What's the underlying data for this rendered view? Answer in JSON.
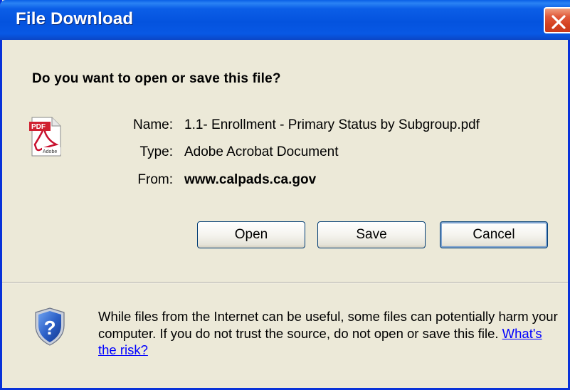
{
  "window": {
    "title": "File Download",
    "close_icon": "close-icon"
  },
  "dialog": {
    "question": "Do you want to open or save this file?",
    "file_icon": "pdf-file-icon",
    "fields": [
      {
        "label": "Name:",
        "value": "1.1- Enrollment - Primary Status by Subgroup.pdf",
        "bold": false
      },
      {
        "label": "Type:",
        "value": "Adobe Acrobat Document",
        "bold": false
      },
      {
        "label": "From:",
        "value": "www.calpads.ca.gov",
        "bold": true
      }
    ],
    "buttons": {
      "open": "Open",
      "save": "Save",
      "cancel": "Cancel"
    }
  },
  "footer": {
    "shield_icon": "security-shield-question-icon",
    "warning_text": "While files from the Internet can be useful, some files can potentially harm your computer. If you do not trust the source, do not open or save this file.",
    "risk_link": "What's the risk?"
  },
  "colors": {
    "titlebar": "#0453de",
    "dialog_bg": "#ece9d8",
    "close_button": "#d4411f",
    "link": "#0000ff"
  }
}
